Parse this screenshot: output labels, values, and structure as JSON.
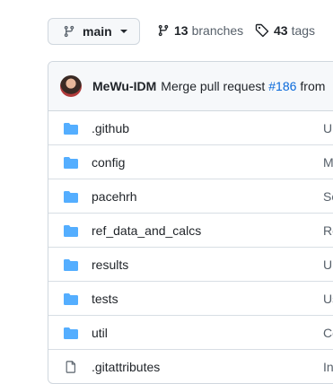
{
  "branch": {
    "name": "main",
    "icon": "git-branch-icon"
  },
  "branches": {
    "count": "13",
    "label": "branches"
  },
  "tags": {
    "count": "43",
    "label": "tags"
  },
  "commit": {
    "author": "MeWu-IDM",
    "message": "Merge pull request",
    "pr_link": "#186",
    "tail": "from"
  },
  "files": [
    {
      "name": ".github",
      "type": "folder",
      "msg": "Up"
    },
    {
      "name": "config",
      "type": "folder",
      "msg": "M"
    },
    {
      "name": "pacehrh",
      "type": "folder",
      "msg": "Sc"
    },
    {
      "name": "ref_data_and_calcs",
      "type": "folder",
      "msg": "Re"
    },
    {
      "name": "results",
      "type": "folder",
      "msg": "Up"
    },
    {
      "name": "tests",
      "type": "folder",
      "msg": "Us"
    },
    {
      "name": "util",
      "type": "folder",
      "msg": "Co"
    },
    {
      "name": ".gitattributes",
      "type": "file",
      "msg": "In"
    }
  ],
  "colors": {
    "folder": "#54aeff",
    "link": "#0969da",
    "border": "#d0d7de"
  }
}
